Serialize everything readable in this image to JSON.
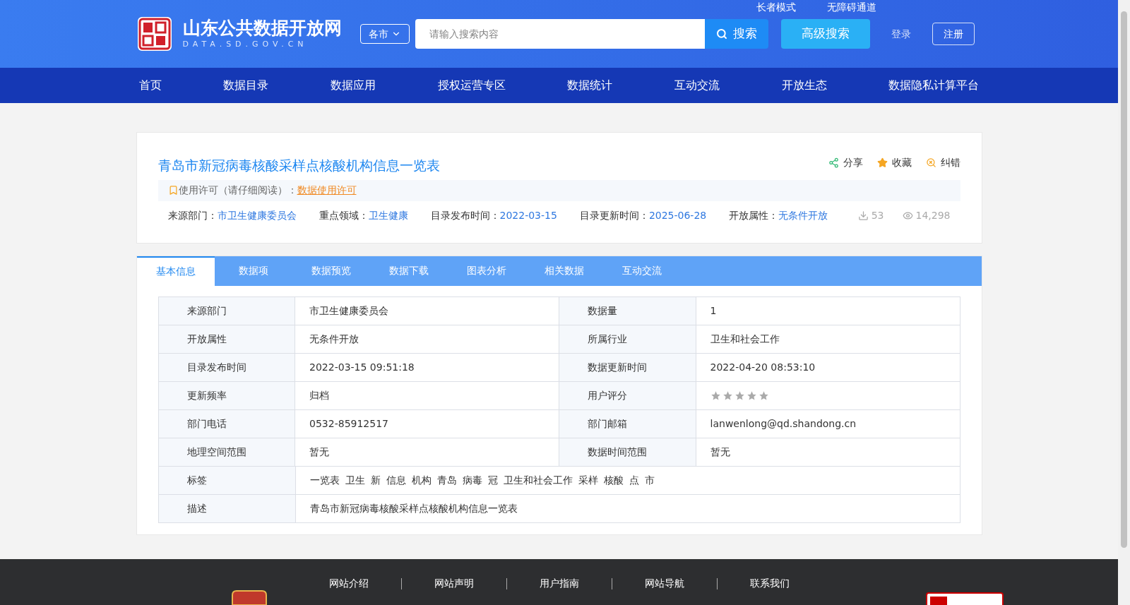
{
  "header": {
    "site_name": "山东公共数据开放网",
    "site_domain": "DATA.SD.GOV.CN",
    "top_links": [
      "长者模式",
      "无障碍通道"
    ],
    "city_select": "各市",
    "search": {
      "placeholder": "请输入搜索内容",
      "button": "搜索"
    },
    "advanced_search": "高级搜索",
    "login": "登录",
    "register": "注册"
  },
  "nav": [
    {
      "label": "首页",
      "selected": false
    },
    {
      "label": "数据目录",
      "selected": false
    },
    {
      "label": "数据应用",
      "selected": false
    },
    {
      "label": "授权运营专区",
      "selected": false
    },
    {
      "label": "数据统计",
      "selected": false
    },
    {
      "label": "互动交流",
      "selected": false
    },
    {
      "label": "开放生态",
      "selected": false
    },
    {
      "label": "数据隐私计算平台",
      "selected": false
    }
  ],
  "dataset": {
    "title": "青岛市新冠病毒核酸采样点核酸机构信息一览表",
    "actions": [
      "分享",
      "收藏",
      "纠错"
    ],
    "license_label": "使用许可（请仔细阅读）：",
    "license_link": "数据使用许可",
    "meta": [
      {
        "label": "来源部门：",
        "value": "市卫生健康委员会"
      },
      {
        "label": "重点领域：",
        "value": "卫生健康"
      },
      {
        "label": "目录发布时间：",
        "value": "2022-03-15"
      },
      {
        "label": "目录更新时间：",
        "value": "2025-06-28"
      },
      {
        "label": "开放属性：",
        "value": "无条件开放"
      }
    ],
    "downloads": "53",
    "views": "14,298"
  },
  "tabs": [
    {
      "label": "基本信息",
      "selected": true
    },
    {
      "label": "数据项",
      "selected": false
    },
    {
      "label": "数据预览",
      "selected": false
    },
    {
      "label": "数据下载",
      "selected": false
    },
    {
      "label": "图表分析",
      "selected": false
    },
    {
      "label": "相关数据",
      "selected": false
    },
    {
      "label": "互动交流",
      "selected": false
    }
  ],
  "info_rows": [
    {
      "cells": [
        {
          "label": "来源部门",
          "value": "市卫生健康委员会"
        },
        {
          "label": "数据量",
          "value": "1"
        }
      ]
    },
    {
      "cells": [
        {
          "label": "开放属性",
          "value": "无条件开放"
        },
        {
          "label": "所属行业",
          "value": "卫生和社会工作"
        }
      ]
    },
    {
      "cells": [
        {
          "label": "目录发布时间",
          "value": "2022-03-15 09:51:18"
        },
        {
          "label": "数据更新时间",
          "value": "2022-04-20 08:53:10"
        }
      ]
    },
    {
      "cells": [
        {
          "label": "更新频率",
          "value": "归档"
        },
        {
          "label": "用户评分",
          "stars": 0
        }
      ]
    },
    {
      "cells": [
        {
          "label": "部门电话",
          "value": "0532-85912517"
        },
        {
          "label": "部门邮箱",
          "value": "lanwenlong@qd.shandong.cn"
        }
      ]
    },
    {
      "cells": [
        {
          "label": "地理空间范围",
          "value": "暂无"
        },
        {
          "label": "数据时间范围",
          "value": "暂无"
        }
      ]
    },
    {
      "cells": [
        {
          "label": "标签",
          "tags": [
            "一览表",
            "卫生",
            "新",
            "信息",
            "机构",
            "青岛",
            "病毒",
            "冠",
            "卫生和社会工作",
            "采样",
            "核酸",
            "点",
            "市"
          ]
        }
      ]
    },
    {
      "cells": [
        {
          "label": "描述",
          "value": "青岛市新冠病毒核酸采样点核酸机构信息一览表"
        }
      ]
    }
  ],
  "footer": {
    "links": [
      "网站介绍",
      "网站声明",
      "用户指南",
      "网站导航",
      "联系我们"
    ]
  }
}
